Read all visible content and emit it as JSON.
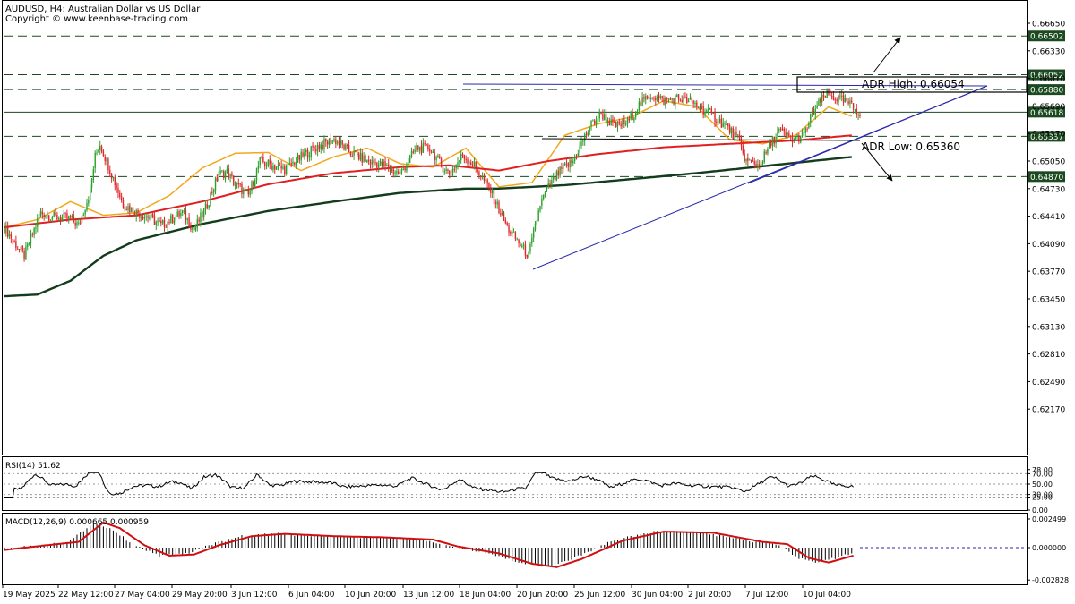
{
  "header": {
    "symbol_line": "AUDUSD, H4:  Australian Dollar vs US Dollar",
    "copyright": "Copyright © www.keenbase-trading.com"
  },
  "colors": {
    "bull": "#2ca02c",
    "bear": "#e0282b",
    "ema_fast": "#f2a81c",
    "ema_mid": "#e02020",
    "ema_slow": "#123c1c",
    "dashed_level": "#1c4a20",
    "trendline": "#2a2aa8",
    "macd_signal": "#d01010",
    "macd_hist": "#000000",
    "rsi": "#000000"
  },
  "chart_data": [
    {
      "type": "candlestick",
      "title": "AUDUSD, H4",
      "y_ticks": [
        "0.66650",
        "0.66330",
        "0.66010",
        "0.65690",
        "0.65370",
        "0.65050",
        "0.64730",
        "0.64410",
        "0.64090",
        "0.63770",
        "0.63450",
        "0.63130",
        "0.62810",
        "0.62490",
        "0.62170"
      ],
      "ylim": [
        0.6184,
        0.6682
      ],
      "x_ticks": [
        "19 May 2025",
        "22 May 12:00",
        "27 May 04:00",
        "29 May 20:00",
        "3 Jun 12:00",
        "6 Jun 04:00",
        "10 Jun 20:00",
        "13 Jun 12:00",
        "18 Jun 04:00",
        "20 Jun 20:00",
        "25 Jun 12:00",
        "30 Jun 04:00",
        "2 Jul 20:00",
        "7 Jul 12:00",
        "10 Jul 04:00"
      ],
      "levels": [
        {
          "price": 0.66502,
          "label": "0.66502"
        },
        {
          "price": 0.66052,
          "label": "0.66052"
        },
        {
          "price": 0.6588,
          "label": "0.65880"
        },
        {
          "price": 0.65618,
          "label": "0.65618"
        },
        {
          "price": 0.65337,
          "label": "0.65337"
        },
        {
          "price": 0.6487,
          "label": "0.64870"
        }
      ],
      "annotations": {
        "adr_high": "ADR High: 0.66054",
        "adr_low": "ADR Low: 0.65360"
      },
      "series": [
        {
          "name": "EMA fast",
          "anchors": [
            [
              0,
              0.6428
            ],
            [
              20,
              0.6437
            ],
            [
              40,
              0.6458
            ],
            [
              60,
              0.6442
            ],
            [
              80,
              0.6445
            ],
            [
              100,
              0.6465
            ],
            [
              120,
              0.6497
            ],
            [
              140,
              0.6514
            ],
            [
              160,
              0.6515
            ],
            [
              180,
              0.6494
            ],
            [
              200,
              0.651
            ],
            [
              220,
              0.652
            ],
            [
              240,
              0.6502
            ],
            [
              260,
              0.6498
            ],
            [
              280,
              0.652
            ],
            [
              300,
              0.6475
            ],
            [
              320,
              0.648
            ],
            [
              340,
              0.6535
            ],
            [
              360,
              0.6548
            ],
            [
              380,
              0.6556
            ],
            [
              400,
              0.6575
            ],
            [
              420,
              0.6568
            ],
            [
              440,
              0.653
            ],
            [
              460,
              0.6525
            ],
            [
              480,
              0.6535
            ],
            [
              500,
              0.6568
            ],
            [
              515,
              0.6556
            ]
          ]
        },
        {
          "name": "EMA mid",
          "anchors": [
            [
              0,
              0.6428
            ],
            [
              40,
              0.6437
            ],
            [
              80,
              0.6442
            ],
            [
              120,
              0.6458
            ],
            [
              160,
              0.6478
            ],
            [
              200,
              0.6491
            ],
            [
              240,
              0.6498
            ],
            [
              270,
              0.65
            ],
            [
              300,
              0.6494
            ],
            [
              330,
              0.6505
            ],
            [
              360,
              0.6513
            ],
            [
              400,
              0.6521
            ],
            [
              440,
              0.6525
            ],
            [
              480,
              0.6529
            ],
            [
              515,
              0.6535
            ]
          ]
        },
        {
          "name": "EMA slow",
          "anchors": [
            [
              0,
              0.6348
            ],
            [
              20,
              0.635
            ],
            [
              40,
              0.6366
            ],
            [
              60,
              0.6395
            ],
            [
              80,
              0.6413
            ],
            [
              120,
              0.6432
            ],
            [
              160,
              0.6447
            ],
            [
              200,
              0.6458
            ],
            [
              240,
              0.6468
            ],
            [
              280,
              0.6473
            ],
            [
              300,
              0.6473
            ],
            [
              340,
              0.6477
            ],
            [
              380,
              0.6484
            ],
            [
              420,
              0.6491
            ],
            [
              460,
              0.6499
            ],
            [
              515,
              0.651
            ]
          ]
        }
      ]
    },
    {
      "type": "line",
      "title": "RSI(14) 51.62",
      "y_ticks": [
        "78.00",
        "70.00",
        "50.00",
        "30.00",
        "25.00",
        "0.00"
      ],
      "ylim": [
        0,
        100
      ],
      "value": 51.62
    },
    {
      "type": "bar",
      "title": "MACD(12,26,9) 0.000665 0.000959",
      "y_ticks": [
        "0.002499",
        "0.000000",
        "-0.002828"
      ],
      "ylim": [
        -0.002828,
        0.002499
      ],
      "signal_anchors": [
        [
          0,
          -0.0002
        ],
        [
          25,
          0.0002
        ],
        [
          45,
          0.0005
        ],
        [
          60,
          0.0022
        ],
        [
          70,
          0.0017
        ],
        [
          85,
          0.0002
        ],
        [
          100,
          -0.0007
        ],
        [
          115,
          -0.0006
        ],
        [
          130,
          0.0002
        ],
        [
          150,
          0.001
        ],
        [
          170,
          0.0012
        ],
        [
          200,
          0.001
        ],
        [
          230,
          0.0009
        ],
        [
          260,
          0.0007
        ],
        [
          275,
          0.0001
        ],
        [
          300,
          -0.0005
        ],
        [
          320,
          -0.0014
        ],
        [
          335,
          -0.0017
        ],
        [
          350,
          -0.001
        ],
        [
          375,
          0.0006
        ],
        [
          400,
          0.0014
        ],
        [
          430,
          0.0013
        ],
        [
          460,
          0.0005
        ],
        [
          475,
          0.0003
        ],
        [
          488,
          -0.0009
        ],
        [
          500,
          -0.0013
        ],
        [
          515,
          -0.0007
        ],
        [
          540,
          -0.0001
        ],
        [
          560,
          0.0007
        ],
        [
          570,
          0.0011
        ],
        [
          578,
          0.0009
        ]
      ]
    }
  ]
}
